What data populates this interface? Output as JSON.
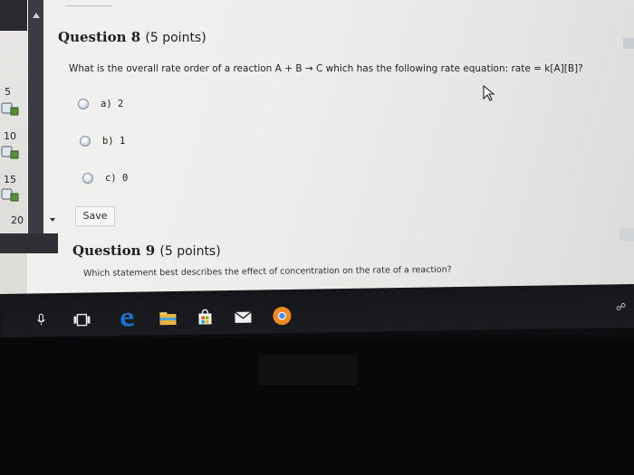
{
  "sidebar": {
    "pages": [
      {
        "num": "5"
      },
      {
        "num": "10"
      },
      {
        "num": "15"
      },
      {
        "num": "20"
      }
    ]
  },
  "question8": {
    "title": "Question 8",
    "points": "(5 points)",
    "text": "What is the overall rate order of a reaction A + B → C which has the following rate equation: rate = k[A][B]?",
    "options": [
      {
        "label": "a) 2"
      },
      {
        "label": "b) 1"
      },
      {
        "label": "c) 0"
      }
    ],
    "save_label": "Save"
  },
  "question9": {
    "title": "Question 9",
    "points": "(5 points)",
    "text": "Which statement best describes the effect of concentration on the rate of a reaction?"
  },
  "taskbar": {
    "icons": [
      "task-view-icon",
      "edge-icon",
      "file-explorer-icon",
      "store-icon",
      "mail-icon",
      "chrome-icon"
    ]
  },
  "colors": {
    "screen_bg": "#f0efed",
    "sidebar_dark": "#3a3c42",
    "taskbar": "#17181c",
    "edge_blue": "#1a73c8",
    "chrome_orange": "#f28a1c"
  }
}
